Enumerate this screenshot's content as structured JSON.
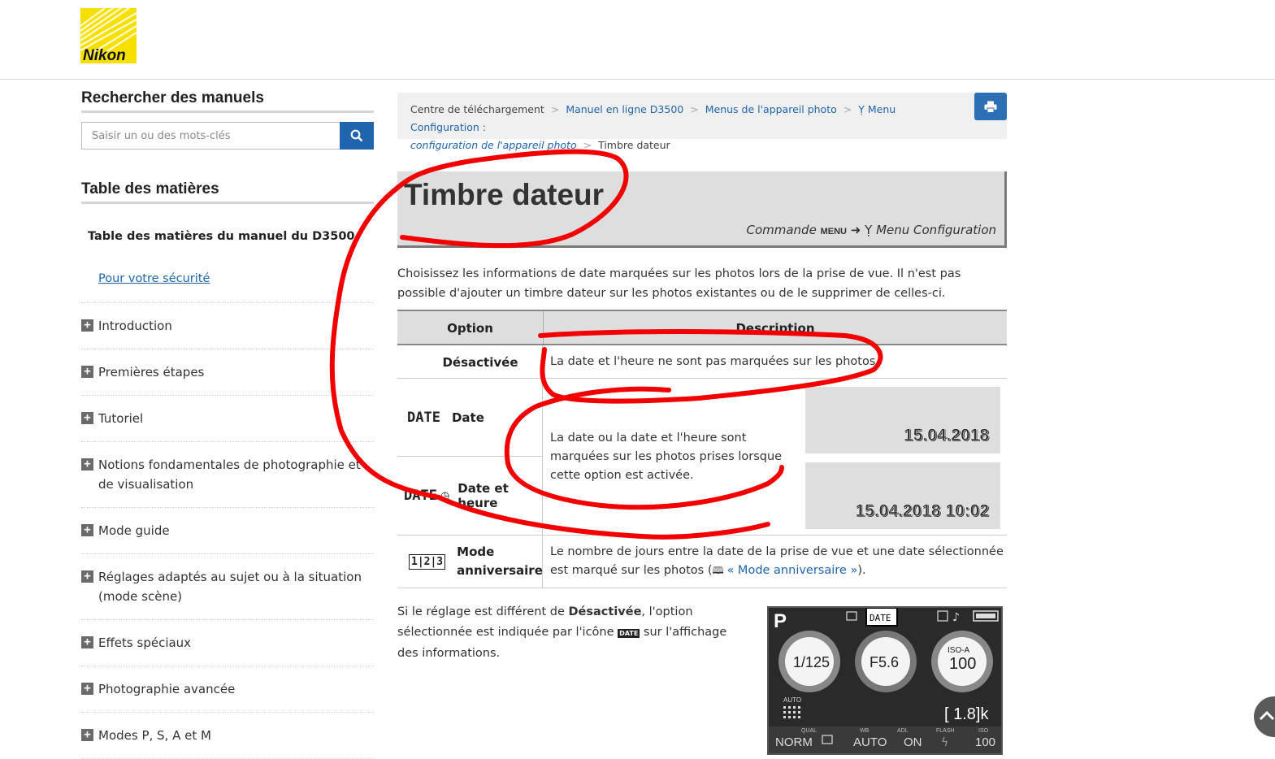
{
  "logo": {
    "text": "Nikon"
  },
  "sidebar": {
    "search_heading": "Rechercher des manuels",
    "search_placeholder": "Saisir un ou des mots-clés",
    "toc_heading": "Table des matières",
    "toc_title": "Table des matières du manuel du D3500",
    "safety_link": "Pour votre sécurité",
    "items": [
      {
        "label": "Introduction"
      },
      {
        "label": "Premières étapes"
      },
      {
        "label": "Tutoriel"
      },
      {
        "label": "Notions fondamentales de photographie et de visualisation"
      },
      {
        "label": "Mode guide"
      },
      {
        "label": "Réglages adaptés au sujet ou à la situation (mode scène)"
      },
      {
        "label": "Effets spéciaux"
      },
      {
        "label": "Photographie avancée"
      },
      {
        "label": "Modes P, S, A et M"
      }
    ]
  },
  "breadcrumb": {
    "c1": "Centre de téléchargement",
    "c2": "Manuel en ligne D3500",
    "c3": "Menus de l'appareil photo",
    "c4a": "Menu Configuration :",
    "c4b": "configuration de l'appareil photo",
    "c5": "Timbre dateur",
    "separator": ">"
  },
  "page": {
    "title": "Timbre dateur",
    "command_prefix": "Commande",
    "command_key": "MENU",
    "command_arrow": "➜",
    "command_suffix": "Menu Configuration",
    "intro": "Choisissez les informations de date marquées sur les photos lors de la prise de vue. Il n'est pas possible d'ajouter un timbre dateur sur les photos existantes ou de le supprimer de celles-ci."
  },
  "table": {
    "col_option": "Option",
    "col_description": "Description",
    "rows": {
      "off_label": "Désactivée",
      "off_desc": "La date et l'heure ne sont pas marquées sur les photos.",
      "date_icon": "DATE",
      "date_label": "Date",
      "datetime_icon": "DATE",
      "datetime_label": "Date et heure",
      "date_desc": "La date ou la date et l'heure sont marquées sur les photos prises lorsque cette option est activée.",
      "date_sample": "15.04.2018",
      "datetime_sample": "15.04.2018 10:02",
      "anniv_icon": "1|2|3",
      "anniv_label_1": "Mode",
      "anniv_label_2": "anniversaire",
      "anniv_desc_1": "Le nombre de jours entre la date de la prise de vue et une date sélectionnée est marqué sur les photos (",
      "anniv_link": "« Mode anniversaire »",
      "anniv_desc_2": ")."
    }
  },
  "bottom": {
    "t1": "Si le réglage est différent de ",
    "t_bold": "Désactivée",
    "t2": ", l'option sélectionnée est indiquée par l'icône ",
    "t_icon": "DATE",
    "t3": " sur l'affichage des informations."
  },
  "lcd": {
    "mode": "P",
    "date_badge": "DATE",
    "shutter": "1/125",
    "aperture": "F5.6",
    "iso_label": "ISO-A",
    "iso_value": "100",
    "auto": "AUTO",
    "exposures": "[ 1.8]k",
    "bottom_labels": [
      "QUAL",
      "WB",
      "ADL",
      "FLASH",
      "ISO"
    ],
    "bottom_values": [
      "NORM",
      "AUTO",
      "ON",
      "100"
    ]
  },
  "colors": {
    "accent": "#1f64ad",
    "annotation": "#ff0000",
    "table_header": "#dedede"
  }
}
